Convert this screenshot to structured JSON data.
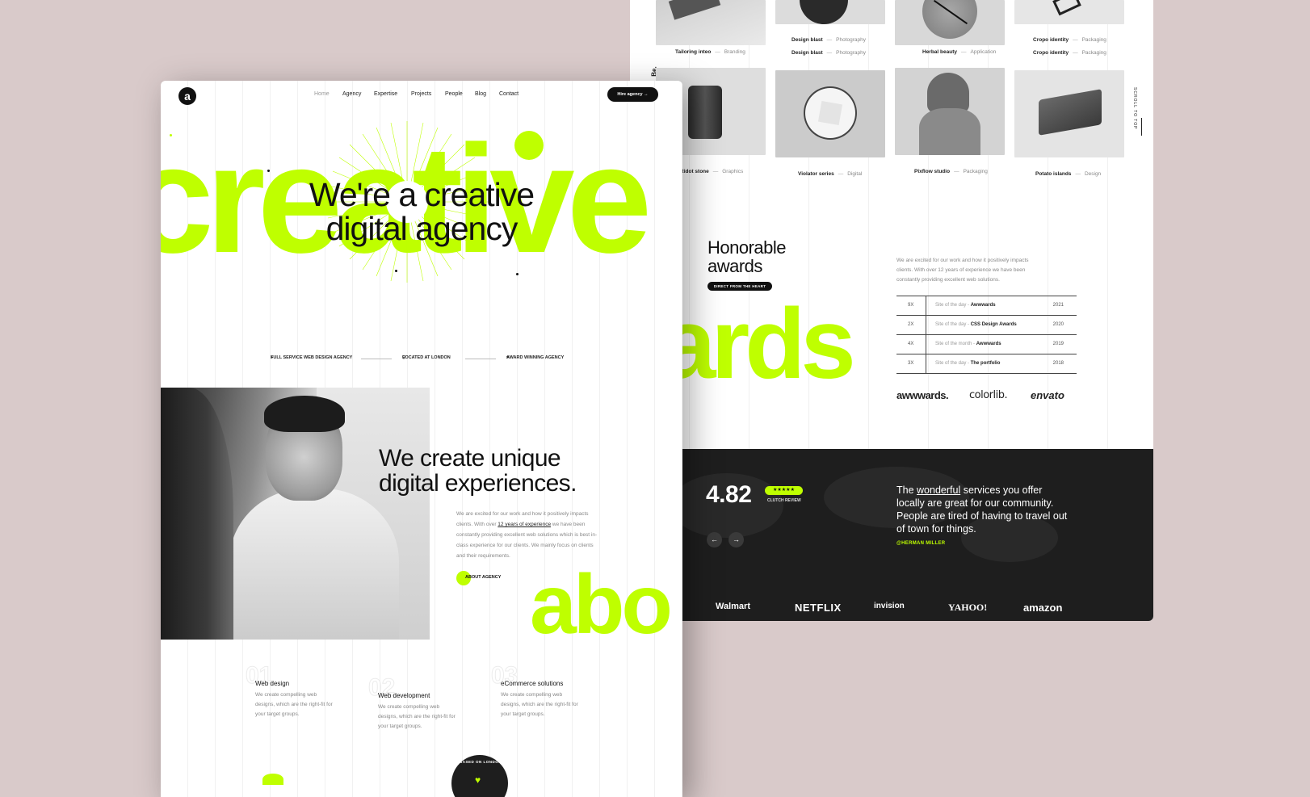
{
  "right": {
    "be_label": "Be.",
    "scroll_label": "SCROLL TO TOP",
    "gallery": [
      {
        "title": "Tailoring inteo",
        "category": "Branding"
      },
      {
        "title": "Design blast",
        "category": "Photography"
      },
      {
        "title": "Design blast",
        "category": "Photography"
      },
      {
        "title": "Herbal beauty",
        "category": "Application"
      },
      {
        "title": "Cropo identity",
        "category": "Packaging"
      },
      {
        "title": "Cropo identity",
        "category": "Packaging"
      },
      {
        "title": "Ridot stone",
        "category": "Graphics"
      },
      {
        "title": "Violator series",
        "category": "Digital"
      },
      {
        "title": "Pixflow studio",
        "category": "Packaging"
      },
      {
        "title": "Potato islands",
        "category": "Design"
      }
    ],
    "separator": "—",
    "awards": {
      "title_line1": "Honorable",
      "title_line2": "awards",
      "button": "DIRECT FROM THE HEART",
      "desc": "We are excited for our work and how it positively impacts clients. With over 12 years of experience we have been constantly providing excellent web solutions.",
      "big_word": "ards",
      "rows": [
        {
          "count": "9X",
          "label": "Site of the day -",
          "name": "Awwwards",
          "year": "2021"
        },
        {
          "count": "2X",
          "label": "Site of the day -",
          "name": "CSS Design Awards",
          "year": "2020"
        },
        {
          "count": "4X",
          "label": "Site of the month -",
          "name": "Awwwards",
          "year": "2019"
        },
        {
          "count": "3X",
          "label": "Site of the day -",
          "name": "The portfolio",
          "year": "2018"
        }
      ],
      "logos": [
        "awwwards.",
        "colorlib.",
        "envato"
      ]
    },
    "review": {
      "rating": "4.82",
      "stars": "★★★★★",
      "source": "CLUTCH REVIEW",
      "prev": "←",
      "next": "→",
      "quote_a": "The ",
      "quote_u": "wonderful",
      "quote_b": " services you offer locally are great for our community. People are tired of having to travel out of town for things.",
      "author": "@HERMAN MILLER"
    },
    "brands": [
      "Walmart",
      "NETFLIX",
      "invision",
      "YAHOO!",
      "amazon"
    ]
  },
  "left": {
    "logo": "a",
    "nav": [
      "Home",
      "Agency",
      "Expertise",
      "Projects",
      "People",
      "Blog",
      "Contact"
    ],
    "hire": "Hire agency →",
    "bg_word": "creative",
    "hero_line1": "We're a creative",
    "hero_line2": "digital agency",
    "features": [
      "FULL SERVICE WEB DESIGN AGENCY",
      "LOCATED AT LONDON",
      "AWARD WINNING AGENCY"
    ],
    "feature_icons": [
      "●",
      "⚲",
      "♥"
    ],
    "unique_line1": "We create unique",
    "unique_line2": "digital experiences.",
    "unique_desc_a": "We are excited for our work and how it positively impacts clients. With over ",
    "unique_desc_u": "12 years of experience",
    "unique_desc_b": " we have been constantly providing excellent web solutions which is best in-class experience for our clients. We mainly focus on clients and their requirements.",
    "about_btn": "ABOUT AGENCY",
    "abo_word": "abo",
    "services": [
      {
        "num": "01",
        "title": "Web design",
        "desc": "We create compelling web designs, which are the right-fit for your target groups."
      },
      {
        "num": "02",
        "title": "Web development",
        "desc": "We create compelling web designs, which are the right-fit for your target groups."
      },
      {
        "num": "03",
        "title": "eCommerce solutions",
        "desc": "We create compelling web designs, which are the right-fit for your target groups."
      }
    ],
    "badge_text": "BASED ON LONDON",
    "badge_icon": "♥"
  },
  "colors": {
    "accent": "#bfff00",
    "dark": "#1e1e1e",
    "backdrop": "#d9caca"
  }
}
